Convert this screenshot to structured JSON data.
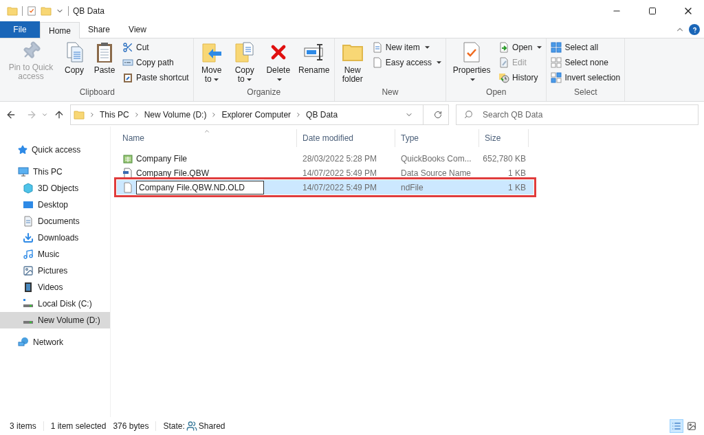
{
  "window": {
    "title": "QB Data"
  },
  "tabs": [
    {
      "label": "File",
      "kind": "file",
      "selected": false
    },
    {
      "label": "Home",
      "kind": "tab",
      "selected": true
    },
    {
      "label": "Share",
      "kind": "tab",
      "selected": false
    },
    {
      "label": "View",
      "kind": "tab",
      "selected": false
    }
  ],
  "ribbon": {
    "groups": [
      {
        "label": "Clipboard",
        "items": [
          {
            "kind": "large",
            "label": "Pin to Quick access",
            "disabled": true,
            "dropdown": false
          },
          {
            "kind": "large",
            "label": "Copy",
            "disabled": false,
            "dropdown": false
          },
          {
            "kind": "large",
            "label": "Paste",
            "disabled": false,
            "dropdown": false
          },
          {
            "kind": "small",
            "label": "Cut",
            "disabled": false,
            "dropdown": false
          },
          {
            "kind": "small",
            "label": "Copy path",
            "disabled": false,
            "dropdown": false
          },
          {
            "kind": "small",
            "label": "Paste shortcut",
            "disabled": false,
            "dropdown": false
          }
        ]
      },
      {
        "label": "Organize",
        "items": [
          {
            "kind": "large",
            "label": "Move to",
            "disabled": false,
            "dropdown": true
          },
          {
            "kind": "large",
            "label": "Copy to",
            "disabled": false,
            "dropdown": true
          },
          {
            "kind": "large",
            "label": "Delete",
            "disabled": false,
            "dropdown": true
          },
          {
            "kind": "large",
            "label": "Rename",
            "disabled": false,
            "dropdown": false
          }
        ]
      },
      {
        "label": "New",
        "items": [
          {
            "kind": "large",
            "label": "New folder",
            "disabled": false,
            "dropdown": false
          },
          {
            "kind": "small",
            "label": "New item",
            "disabled": false,
            "dropdown": true
          },
          {
            "kind": "small",
            "label": "Easy access",
            "disabled": false,
            "dropdown": true
          }
        ]
      },
      {
        "label": "Open",
        "items": [
          {
            "kind": "large",
            "label": "Properties",
            "disabled": false,
            "dropdown": true
          },
          {
            "kind": "small",
            "label": "Open",
            "disabled": false,
            "dropdown": true
          },
          {
            "kind": "small",
            "label": "Edit",
            "disabled": true,
            "dropdown": false
          },
          {
            "kind": "small",
            "label": "History",
            "disabled": false,
            "dropdown": false
          }
        ]
      },
      {
        "label": "Select",
        "items": [
          {
            "kind": "small",
            "label": "Select all",
            "disabled": false,
            "dropdown": false
          },
          {
            "kind": "small",
            "label": "Select none",
            "disabled": false,
            "dropdown": false
          },
          {
            "kind": "small",
            "label": "Invert selection",
            "disabled": false,
            "dropdown": false
          }
        ]
      }
    ]
  },
  "address": {
    "path": [
      "This PC",
      "New Volume (D:)",
      "Explorer Computer",
      "QB Data"
    ],
    "search": {
      "placeholder": "Search QB Data"
    }
  },
  "sidebar": {
    "items": [
      {
        "label": "Quick access",
        "selected": false
      },
      {
        "label": "This PC",
        "selected": false,
        "children": [
          {
            "label": "3D Objects",
            "selected": false
          },
          {
            "label": "Desktop",
            "selected": false
          },
          {
            "label": "Documents",
            "selected": false
          },
          {
            "label": "Downloads",
            "selected": false
          },
          {
            "label": "Music",
            "selected": false
          },
          {
            "label": "Pictures",
            "selected": false
          },
          {
            "label": "Videos",
            "selected": false
          },
          {
            "label": "Local Disk (C:)",
            "selected": false
          },
          {
            "label": "New Volume (D:)",
            "selected": true
          }
        ]
      },
      {
        "label": "Network",
        "selected": false
      }
    ]
  },
  "table": {
    "columns": [
      "Name",
      "Date modified",
      "Type",
      "Size"
    ],
    "rows": [
      {
        "name": "Company File",
        "date": "28/03/2022 5:28 PM",
        "type": "QuickBooks Com...",
        "size": "652,780 KB",
        "selected": false,
        "editing": false,
        "highlighted": false
      },
      {
        "name": "Company File.QBW",
        "date": "14/07/2022 5:49 PM",
        "type": "Data Source Name",
        "size": "1 KB",
        "selected": false,
        "editing": false,
        "highlighted": false
      },
      {
        "name": "Company File.QBW.ND.OLD",
        "date": "14/07/2022 5:49 PM",
        "type": "ndFile",
        "size": "1 KB",
        "selected": true,
        "editing": true,
        "highlighted": true
      }
    ]
  },
  "status_bar": {
    "count": "3 items",
    "selection": "1 item selected",
    "size": "376 bytes",
    "state_label": "State:",
    "state": "Shared",
    "views": [
      {
        "selected": true
      },
      {
        "selected": false
      }
    ]
  }
}
